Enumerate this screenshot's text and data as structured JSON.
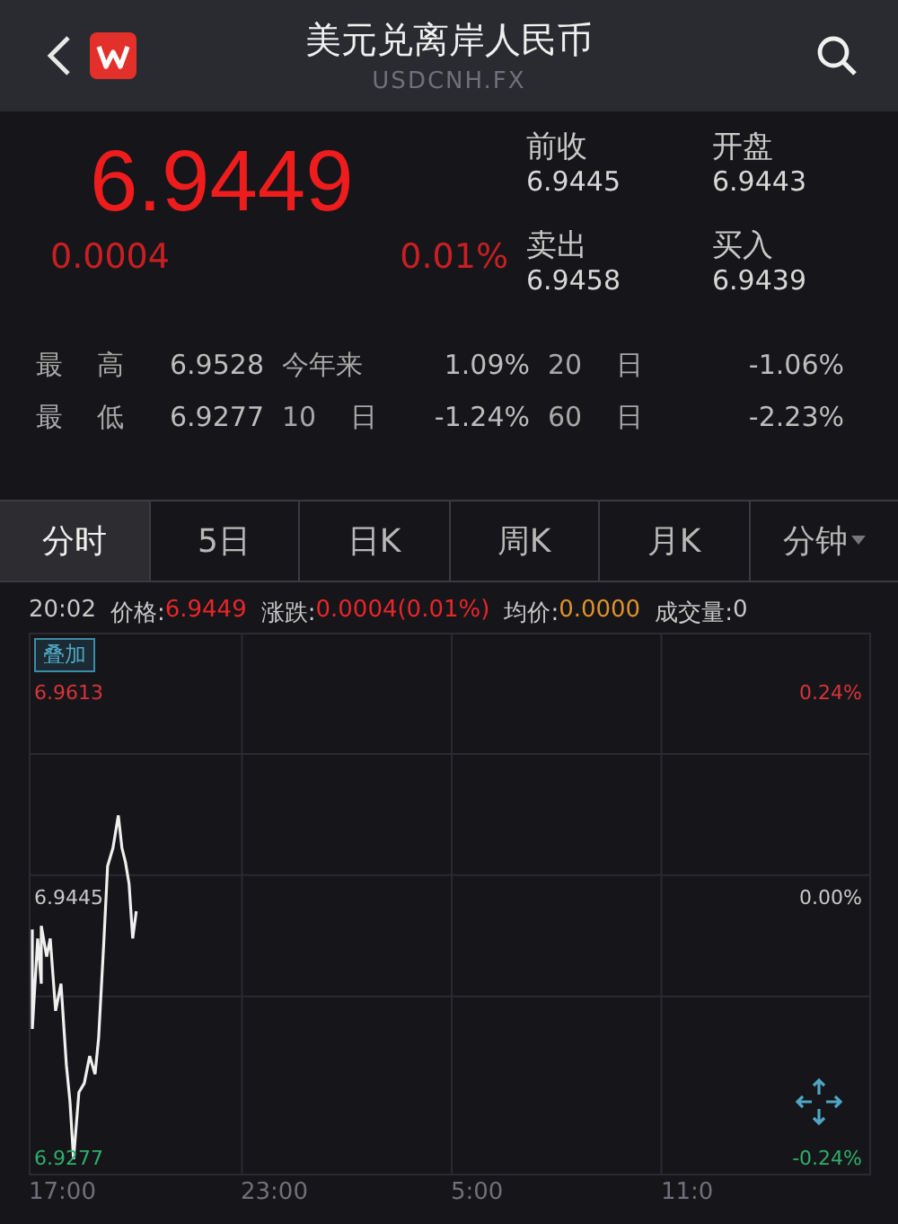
{
  "header": {
    "title": "美元兑离岸人民币",
    "subtitle": "USDCNH.FX"
  },
  "quote": {
    "price": "6.9449",
    "change": "0.0004",
    "change_pct": "0.01%",
    "fields": [
      {
        "label": "前收",
        "value": "6.9445"
      },
      {
        "label": "开盘",
        "value": "6.9443"
      },
      {
        "label": "卖出",
        "value": "6.9458"
      },
      {
        "label": "买入",
        "value": "6.9439"
      }
    ]
  },
  "stats": [
    [
      {
        "label": "最 高",
        "value": "6.9528"
      },
      {
        "label": "今年来",
        "value": "1.09%"
      },
      {
        "label": "20 日",
        "value": "-1.06%"
      }
    ],
    [
      {
        "label": "最 低",
        "value": "6.9277"
      },
      {
        "label": "10 日",
        "value": "-1.24%"
      },
      {
        "label": "60 日",
        "value": "-2.23%"
      }
    ]
  ],
  "tabs": [
    {
      "label": "分时",
      "selected": true,
      "kind": "plain"
    },
    {
      "label": "5日",
      "selected": false,
      "kind": "plain"
    },
    {
      "label": "日K",
      "selected": false,
      "kind": "plain"
    },
    {
      "label": "周K",
      "selected": false,
      "kind": "plain"
    },
    {
      "label": "月K",
      "selected": false,
      "kind": "plain"
    },
    {
      "label": "分钟",
      "selected": false,
      "kind": "dropdown"
    }
  ],
  "info": {
    "time": "20:02",
    "items": [
      {
        "label": "价格:",
        "value": "6.9449",
        "color": "#e8262a"
      },
      {
        "label": "涨跌:",
        "value": "0.0004(0.01%)",
        "color": "#e8262a"
      },
      {
        "label": "均价:",
        "value": "0.0000",
        "color": "#e0922b"
      },
      {
        "label": "成交量:",
        "value": "0",
        "color": "#c8c8c8"
      }
    ]
  },
  "chart": {
    "overlay_button": "叠加",
    "left_labels": [
      {
        "label": "6.9613",
        "color": "#d8343a"
      },
      {
        "label": "6.9445",
        "color": "#c8c8c8"
      },
      {
        "label": "6.9277",
        "color": "#2fae6a"
      }
    ],
    "right_labels": [
      {
        "label": "0.24%",
        "color": "#d8343a"
      },
      {
        "label": "0.00%",
        "color": "#c8c8c8"
      },
      {
        "label": "-0.24%",
        "color": "#2fae6a"
      }
    ],
    "x_labels": [
      "17:00",
      "23:00",
      "5:00",
      "11:0"
    ]
  }
}
